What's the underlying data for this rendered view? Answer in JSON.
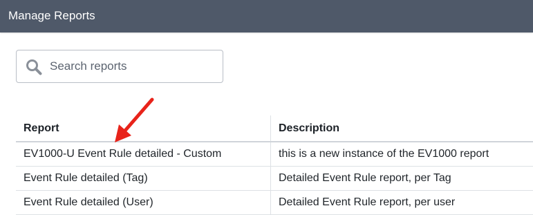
{
  "header": {
    "title": "Manage Reports"
  },
  "search": {
    "placeholder": "Search reports",
    "value": ""
  },
  "table": {
    "columns": [
      "Report",
      "Description"
    ],
    "rows": [
      {
        "report": "EV1000-U Event Rule detailed - Custom",
        "description": "this is a new instance of the EV1000 report"
      },
      {
        "report": "Event Rule detailed (Tag)",
        "description": "Detailed Event Rule report, per Tag"
      },
      {
        "report": "Event Rule detailed (User)",
        "description": "Detailed Event Rule report, per user"
      }
    ]
  },
  "colors": {
    "header_bg": "#4f5969",
    "annotation_arrow": "#e8231a"
  },
  "icons": {
    "search": "search-icon",
    "annotation": "arrow-icon"
  }
}
